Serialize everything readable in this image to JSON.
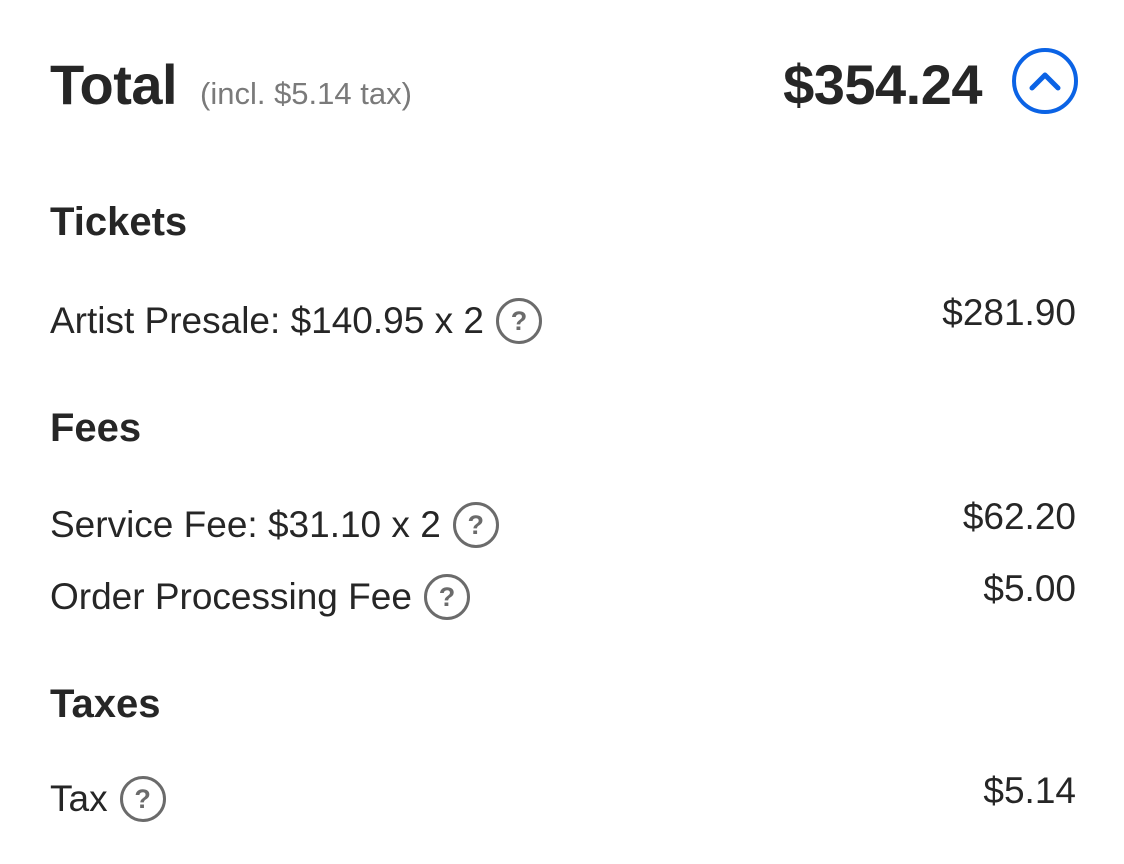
{
  "total": {
    "label": "Total",
    "tax_note": "(incl. $5.14 tax)",
    "amount": "$354.24",
    "toggle_icon": "chevron-up-icon",
    "accent_color": "#0b63e5"
  },
  "sections": {
    "tickets": {
      "heading": "Tickets",
      "items": [
        {
          "label": "Artist Presale: $140.95 x 2",
          "help": "?",
          "amount": "$281.90"
        }
      ]
    },
    "fees": {
      "heading": "Fees",
      "items": [
        {
          "label": "Service Fee: $31.10 x 2",
          "help": "?",
          "amount": "$62.20"
        },
        {
          "label": "Order Processing Fee",
          "help": "?",
          "amount": "$5.00"
        }
      ]
    },
    "taxes": {
      "heading": "Taxes",
      "items": [
        {
          "label": "Tax",
          "help": "?",
          "amount": "$5.14"
        }
      ]
    }
  }
}
